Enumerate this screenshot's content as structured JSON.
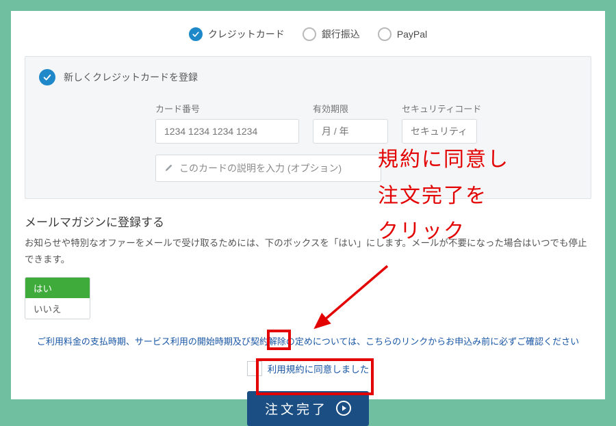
{
  "payment_methods": {
    "credit_card": "クレジットカード",
    "bank_transfer": "銀行振込",
    "paypal": "PayPal"
  },
  "card_panel": {
    "register_new": "新しくクレジットカードを登録",
    "card_number_label": "カード番号",
    "card_number_placeholder": "1234 1234 1234 1234",
    "expiry_label": "有効期限",
    "expiry_placeholder": "月 / 年",
    "cvc_label": "セキュリティコード",
    "cvc_placeholder": "セキュリティ",
    "desc_placeholder": "このカードの説明を入力 (オプション)"
  },
  "mailmag": {
    "title": "メールマガジンに登録する",
    "desc": "お知らせや特別なオファーをメールで受け取るためには、下のボックスを「はい」にします。メールが不要になった場合はいつでも停止できます。",
    "yes": "はい",
    "no": "いいえ"
  },
  "terms_link": "ご利用料金の支払時期、サービス利用の開始時期及び契約解除の定めについては、こちらのリンクからお申込み前に必ずご確認ください",
  "agree_label": "利用規約に同意しました",
  "submit_label": "注文完了",
  "annotation": {
    "line1": "規約に同意し",
    "line2": "注文完了を",
    "line3": "クリック"
  }
}
